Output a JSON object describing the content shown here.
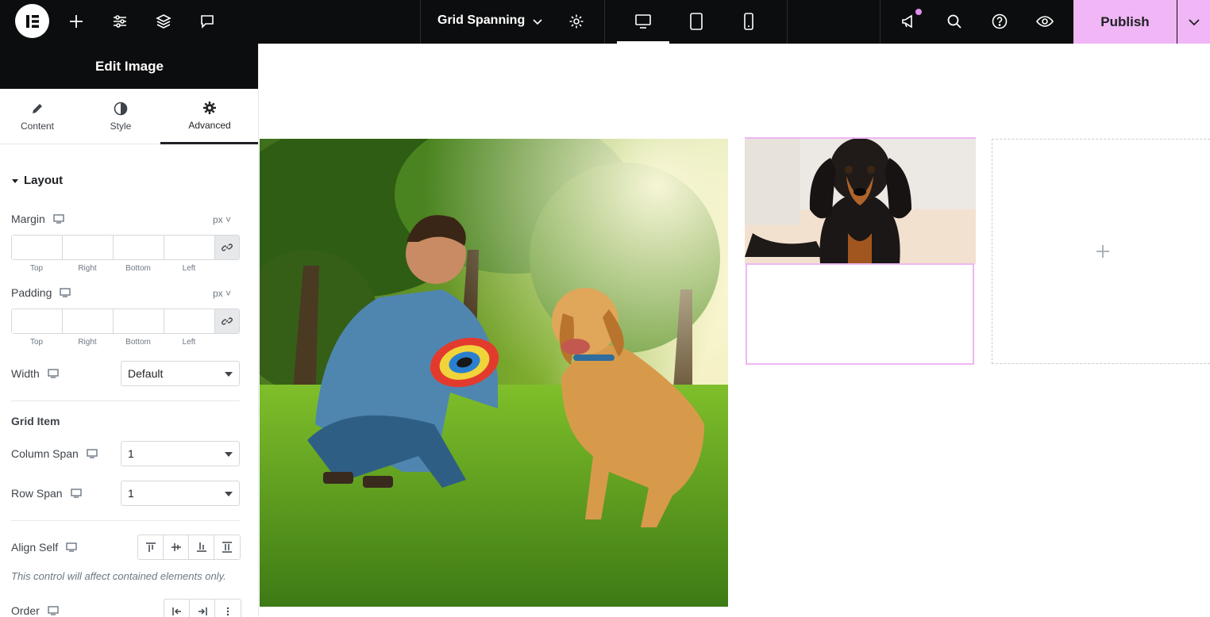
{
  "topbar": {
    "document_title": "Grid Spanning",
    "publish_label": "Publish"
  },
  "panel": {
    "title": "Edit Image",
    "tabs": [
      {
        "label": "Content"
      },
      {
        "label": "Style"
      },
      {
        "label": "Advanced"
      }
    ],
    "layout_section": "Layout",
    "margin": {
      "label": "Margin",
      "unit": "px",
      "sides": [
        "Top",
        "Right",
        "Bottom",
        "Left"
      ]
    },
    "padding": {
      "label": "Padding",
      "unit": "px",
      "sides": [
        "Top",
        "Right",
        "Bottom",
        "Left"
      ]
    },
    "width": {
      "label": "Width",
      "value": "Default"
    },
    "grid_item_title": "Grid Item",
    "column_span": {
      "label": "Column Span",
      "value": "1"
    },
    "row_span": {
      "label": "Row Span",
      "value": "1"
    },
    "align_self": {
      "label": "Align Self"
    },
    "note": "This control will affect contained elements only.",
    "order": {
      "label": "Order"
    }
  },
  "colors": {
    "topbar_bg": "#0c0d0e",
    "publish_bg": "#f0b6f5",
    "selection": "#f0b6f5"
  }
}
